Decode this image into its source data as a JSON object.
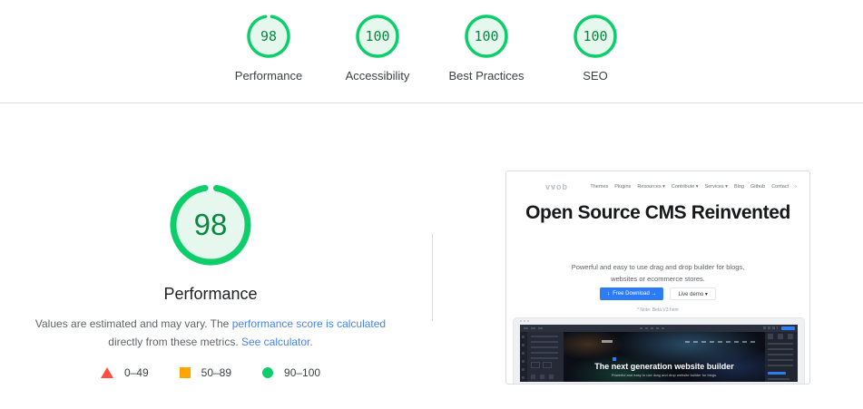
{
  "colors": {
    "accent_green": "#0cce6b",
    "score_text_green": "#0a8745",
    "gauge_fill_green": "#e6f8ed",
    "legend_red": "#ff4e42",
    "legend_orange": "#ffa400",
    "legend_green": "#0cce6b",
    "link_blue": "#4285f4",
    "divider_gray": "#dadce0",
    "thumb_button_blue": "#2d7cf7"
  },
  "summary": {
    "categories": [
      {
        "label": "Performance",
        "score": "98",
        "value": 98
      },
      {
        "label": "Accessibility",
        "score": "100",
        "value": 100
      },
      {
        "label": "Best Practices",
        "score": "100",
        "value": 100
      },
      {
        "label": "SEO",
        "score": "100",
        "value": 100
      }
    ]
  },
  "performance": {
    "score": "98",
    "title": "Performance",
    "line1_text": "Values are estimated and may vary. The",
    "line1_link": "performance score is calculated",
    "line2_text": "directly from these metrics.",
    "line2_link": "See calculator.",
    "legend": [
      {
        "label": "0–49",
        "shape": "triangle",
        "color": "#ff4e42"
      },
      {
        "label": "50–89",
        "shape": "square",
        "color": "#ffa400"
      },
      {
        "label": "90–100",
        "shape": "circle",
        "color": "#0cce6b"
      }
    ]
  },
  "screenshot": {
    "logo": "vvob",
    "nav": [
      "Themes",
      "Plugins",
      "Resources ▾",
      "Contribute ▾",
      "Services ▾",
      "Blog",
      "Github",
      "Contact",
      "›"
    ],
    "headline": "Open Source CMS Reinvented",
    "sub_line1": "Powerful and easy to use drag and drop builder for blogs,",
    "sub_line2": "websites or ecommerce stores.",
    "primary_button": "Free Download →",
    "secondary_button": "Live demo ▾",
    "note": "* Note: Beta V3 here",
    "editor_headline": "The next generation website builder",
    "editor_subtext": "Powerful and easy to use drag and drop website builder for blogs."
  }
}
